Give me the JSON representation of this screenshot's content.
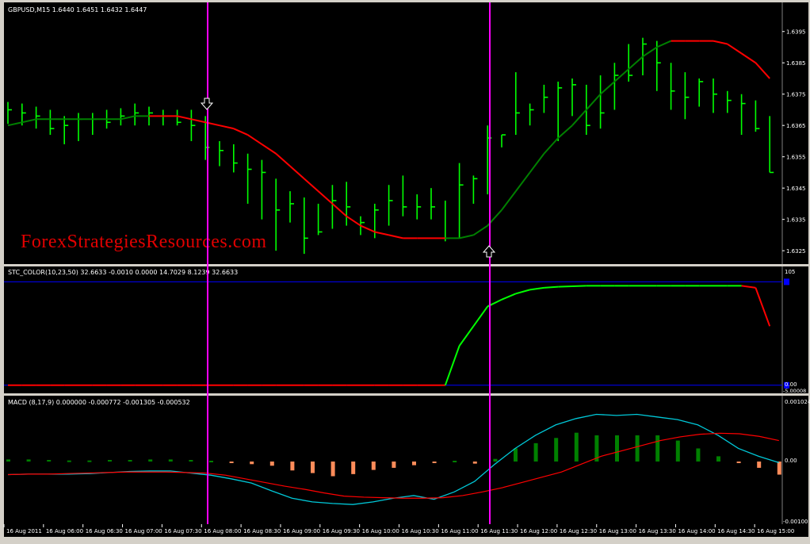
{
  "colors": {
    "background": "#000000",
    "frame": "#d4d0c8",
    "bull_bar": "#00ff00",
    "ma_up": "#008000",
    "ma_down": "#ff0000",
    "vline": "#ff00ff",
    "stc_up": "#00ff00",
    "stc_down": "#ff0000",
    "stc_level": "#0000ff",
    "macd_hist_pos": "#008000",
    "macd_hist_neg": "#ff8c5a",
    "macd_main": "#00c8d8",
    "macd_signal": "#ff0000",
    "axis_text": "#ffffff",
    "watermark": "#ff0000"
  },
  "price_panel": {
    "header": "GBPUSD,M15  1.6440 1.6451 1.6432 1.6447",
    "watermark": "ForexStrategiesResources.com",
    "price_labels": [
      "1.6395",
      "1.6385",
      "1.6375",
      "1.6365",
      "1.6355",
      "1.6345",
      "1.6335",
      "1.6325"
    ],
    "arrows": [
      {
        "type": "down",
        "icon": "down-arrow-icon"
      },
      {
        "type": "up",
        "icon": "up-arrow-icon"
      }
    ]
  },
  "stc_panel": {
    "header": "STC_COLOR(10,23,50) 32.6633 -0.0010 0.0000 14.7029 8.1239 32.6633",
    "level_labels": [
      "105",
      "0.00",
      "-5.00008"
    ]
  },
  "macd_panel": {
    "header": "MACD  (8,17,9) 0.000000 -0.000772 -0.001305 -0.000532",
    "level_labels": [
      "0.001024",
      "0.00",
      "-0.00100"
    ]
  },
  "time_axis": {
    "labels": [
      "16 Aug 2011",
      "16 Aug 06:00",
      "16 Aug 06:30",
      "16 Aug 07:00",
      "16 Aug 07:30",
      "16 Aug 08:00",
      "16 Aug 08:30",
      "16 Aug 09:00",
      "16 Aug 09:30",
      "16 Aug 10:00",
      "16 Aug 10:30",
      "16 Aug 11:00",
      "16 Aug 11:30",
      "16 Aug 12:00",
      "16 Aug 12:30",
      "16 Aug 13:00",
      "16 Aug 13:30",
      "16 Aug 14:00",
      "16 Aug 14:30",
      "16 Aug 15:00"
    ]
  },
  "chart_data": {
    "type": "line",
    "symbol": "GBPUSD",
    "timeframe": "M15",
    "price_bars": [
      {
        "high": 1.63725,
        "low": 1.63655,
        "close": 1.637
      },
      {
        "high": 1.6372,
        "low": 1.6365,
        "close": 1.6369
      },
      {
        "high": 1.6371,
        "low": 1.6364,
        "close": 1.6368
      },
      {
        "high": 1.637,
        "low": 1.6362,
        "close": 1.6364
      },
      {
        "high": 1.6368,
        "low": 1.6359,
        "close": 1.6365
      },
      {
        "high": 1.6369,
        "low": 1.636,
        "close": 1.6367
      },
      {
        "high": 1.6369,
        "low": 1.6362,
        "close": 1.6367
      },
      {
        "high": 1.637,
        "low": 1.6364,
        "close": 1.6366
      },
      {
        "high": 1.63705,
        "low": 1.6365,
        "close": 1.6368
      },
      {
        "high": 1.6372,
        "low": 1.6365,
        "close": 1.6369
      },
      {
        "high": 1.6371,
        "low": 1.6365,
        "close": 1.6369
      },
      {
        "high": 1.637,
        "low": 1.6365,
        "close": 1.6368
      },
      {
        "high": 1.637,
        "low": 1.6365,
        "close": 1.6366
      },
      {
        "high": 1.637,
        "low": 1.636,
        "close": 1.6365
      },
      {
        "high": 1.6368,
        "low": 1.6354,
        "close": 1.6358
      },
      {
        "high": 1.636,
        "low": 1.6352,
        "close": 1.6357
      },
      {
        "high": 1.6359,
        "low": 1.635,
        "close": 1.6353
      },
      {
        "high": 1.6356,
        "low": 1.634,
        "close": 1.6351
      },
      {
        "high": 1.6354,
        "low": 1.6335,
        "close": 1.635
      },
      {
        "high": 1.6348,
        "low": 1.6325,
        "close": 1.6338
      },
      {
        "high": 1.6344,
        "low": 1.6334,
        "close": 1.634
      },
      {
        "high": 1.6342,
        "low": 1.6324,
        "close": 1.6329
      },
      {
        "high": 1.634,
        "low": 1.633,
        "close": 1.6331
      },
      {
        "high": 1.6346,
        "low": 1.6332,
        "close": 1.6341
      },
      {
        "high": 1.6347,
        "low": 1.6333,
        "close": 1.6339
      },
      {
        "high": 1.6336,
        "low": 1.633,
        "close": 1.6334
      },
      {
        "high": 1.634,
        "low": 1.6329,
        "close": 1.6338
      },
      {
        "high": 1.6346,
        "low": 1.6333,
        "close": 1.6341
      },
      {
        "high": 1.6349,
        "low": 1.6336,
        "close": 1.6339
      },
      {
        "high": 1.6343,
        "low": 1.6335,
        "close": 1.6339
      },
      {
        "high": 1.6345,
        "low": 1.6335,
        "close": 1.6339
      },
      {
        "high": 1.6341,
        "low": 1.6328,
        "close": 1.6329
      },
      {
        "high": 1.6353,
        "low": 1.6329,
        "close": 1.6346
      },
      {
        "high": 1.6349,
        "low": 1.634,
        "close": 1.6348
      },
      {
        "high": 1.6365,
        "low": 1.6343,
        "close": 1.6361
      },
      {
        "high": 1.6362,
        "low": 1.6358,
        "close": 1.6362
      },
      {
        "high": 1.6382,
        "low": 1.6362,
        "close": 1.6369
      },
      {
        "high": 1.6372,
        "low": 1.6365,
        "close": 1.637
      },
      {
        "high": 1.6378,
        "low": 1.6369,
        "close": 1.6374
      },
      {
        "high": 1.6379,
        "low": 1.636,
        "close": 1.6377
      },
      {
        "high": 1.638,
        "low": 1.6368,
        "close": 1.6378
      },
      {
        "high": 1.6378,
        "low": 1.6362,
        "close": 1.6365
      },
      {
        "high": 1.6381,
        "low": 1.6364,
        "close": 1.6369
      },
      {
        "high": 1.6385,
        "low": 1.637,
        "close": 1.6381
      },
      {
        "high": 1.6391,
        "low": 1.6379,
        "close": 1.6381
      },
      {
        "high": 1.6393,
        "low": 1.6381,
        "close": 1.6391
      },
      {
        "high": 1.6392,
        "low": 1.6376,
        "close": 1.6385
      },
      {
        "high": 1.6385,
        "low": 1.637,
        "close": 1.6376
      },
      {
        "high": 1.6382,
        "low": 1.6367,
        "close": 1.6374
      },
      {
        "high": 1.638,
        "low": 1.6371,
        "close": 1.6379
      },
      {
        "high": 1.638,
        "low": 1.6369,
        "close": 1.6375
      },
      {
        "high": 1.6376,
        "low": 1.6369,
        "close": 1.6373
      },
      {
        "high": 1.6375,
        "low": 1.6362,
        "close": 1.6372
      },
      {
        "high": 1.6373,
        "low": 1.6363,
        "close": 1.6364
      },
      {
        "high": 1.6368,
        "low": 1.635,
        "close": 1.635
      }
    ],
    "ma_values": [
      1.6365,
      1.6366,
      1.6367,
      1.6367,
      1.6367,
      1.6367,
      1.6367,
      1.6367,
      1.6367,
      1.6368,
      1.6368,
      1.6368,
      1.6368,
      1.6367,
      1.6366,
      1.6365,
      1.6364,
      1.6362,
      1.6359,
      1.6356,
      1.6352,
      1.6348,
      1.6344,
      1.634,
      1.6336,
      1.6333,
      1.6331,
      1.633,
      1.6329,
      1.6329,
      1.6329,
      1.6329,
      1.6329,
      1.633,
      1.6333,
      1.6338,
      1.6344,
      1.635,
      1.6356,
      1.6361,
      1.6365,
      1.637,
      1.6375,
      1.6379,
      1.6383,
      1.6387,
      1.639,
      1.6392,
      1.6392,
      1.6392,
      1.6392,
      1.6391,
      1.6388,
      1.6385,
      1.638
    ],
    "ma_trend": [
      "up",
      "up",
      "up",
      "up",
      "up",
      "up",
      "up",
      "up",
      "up",
      "up",
      "up",
      "down",
      "down",
      "down",
      "down",
      "down",
      "down",
      "down",
      "down",
      "down",
      "down",
      "down",
      "down",
      "down",
      "down",
      "down",
      "down",
      "down",
      "down",
      "down",
      "down",
      "down",
      "up",
      "up",
      "up",
      "up",
      "up",
      "up",
      "up",
      "up",
      "up",
      "up",
      "up",
      "up",
      "up",
      "up",
      "up",
      "up",
      "down",
      "down",
      "down",
      "down",
      "down",
      "down",
      "down"
    ],
    "stc_values": [
      0,
      0,
      0,
      0,
      0,
      0,
      0,
      0,
      0,
      0,
      0,
      0,
      0,
      0,
      0,
      0,
      0,
      0,
      0,
      0,
      0,
      0,
      0,
      0,
      0,
      0,
      0,
      0,
      0,
      0,
      0,
      0,
      40,
      60,
      80,
      87,
      93,
      97,
      99,
      100,
      100.5,
      101,
      101,
      101,
      101,
      101,
      101,
      101,
      101,
      101,
      101,
      101,
      101,
      99,
      60
    ],
    "stc_levels": [
      105,
      0
    ],
    "macd_hist": [
      4e-05,
      4e-05,
      3e-05,
      2e-05,
      2e-05,
      3e-05,
      3e-05,
      4e-05,
      4e-05,
      3e-05,
      1.5e-05,
      -3e-05,
      -5e-05,
      -8e-05,
      -0.00017,
      -0.00022,
      -0.00028,
      -0.00024,
      -0.00016,
      -0.00012,
      -7e-05,
      -3e-05,
      1.5e-05,
      -4e-05,
      5e-05,
      0.00025,
      0.00035,
      0.00045,
      0.00055,
      0.0005,
      0.0005,
      0.0005,
      0.0005,
      0.0004,
      0.00025,
      0.0001,
      -1e-05,
      -0.00012,
      -0.00025
    ],
    "macd_main": [
      -0.00025,
      -0.00024,
      -0.00024,
      -0.00024,
      -0.00023,
      -0.00021,
      -0.00019,
      -0.00018,
      -0.00018,
      -0.00022,
      -0.00026,
      -0.00033,
      -0.00041,
      -0.00056,
      -0.0007,
      -0.00077,
      -0.0008,
      -0.00082,
      -0.00077,
      -0.0007,
      -0.00065,
      -0.00072,
      -0.00058,
      -0.00038,
      -5e-05,
      0.00025,
      0.0005,
      0.0007,
      0.00082,
      0.0009,
      0.00088,
      0.0009,
      0.00085,
      0.0008,
      0.0007,
      0.0005,
      0.00025,
      0.0001,
      -2e-05
    ],
    "macd_signal": [
      -0.00025,
      -0.00024,
      -0.00024,
      -0.00023,
      -0.00022,
      -0.00021,
      -0.0002,
      -0.0002,
      -0.0002,
      -0.00021,
      -0.00022,
      -0.00026,
      -0.00033,
      -0.0004,
      -0.00047,
      -0.00053,
      -0.0006,
      -0.00066,
      -0.00068,
      -0.00069,
      -0.0007,
      -0.0007,
      -0.00069,
      -0.00065,
      -0.00058,
      -0.0005,
      -0.0004,
      -0.0003,
      -0.0002,
      -5e-05,
      0.0001,
      0.0002,
      0.0003,
      0.0004,
      0.00047,
      0.00052,
      0.00054,
      0.00053,
      0.00048,
      0.0004
    ],
    "price_ylim": [
      1.6322,
      1.64
    ],
    "stc_ylim": [
      -5,
      115
    ],
    "macd_ylim": [
      -0.00115,
      0.00115
    ],
    "signal_bars": [
      11,
      32
    ]
  }
}
